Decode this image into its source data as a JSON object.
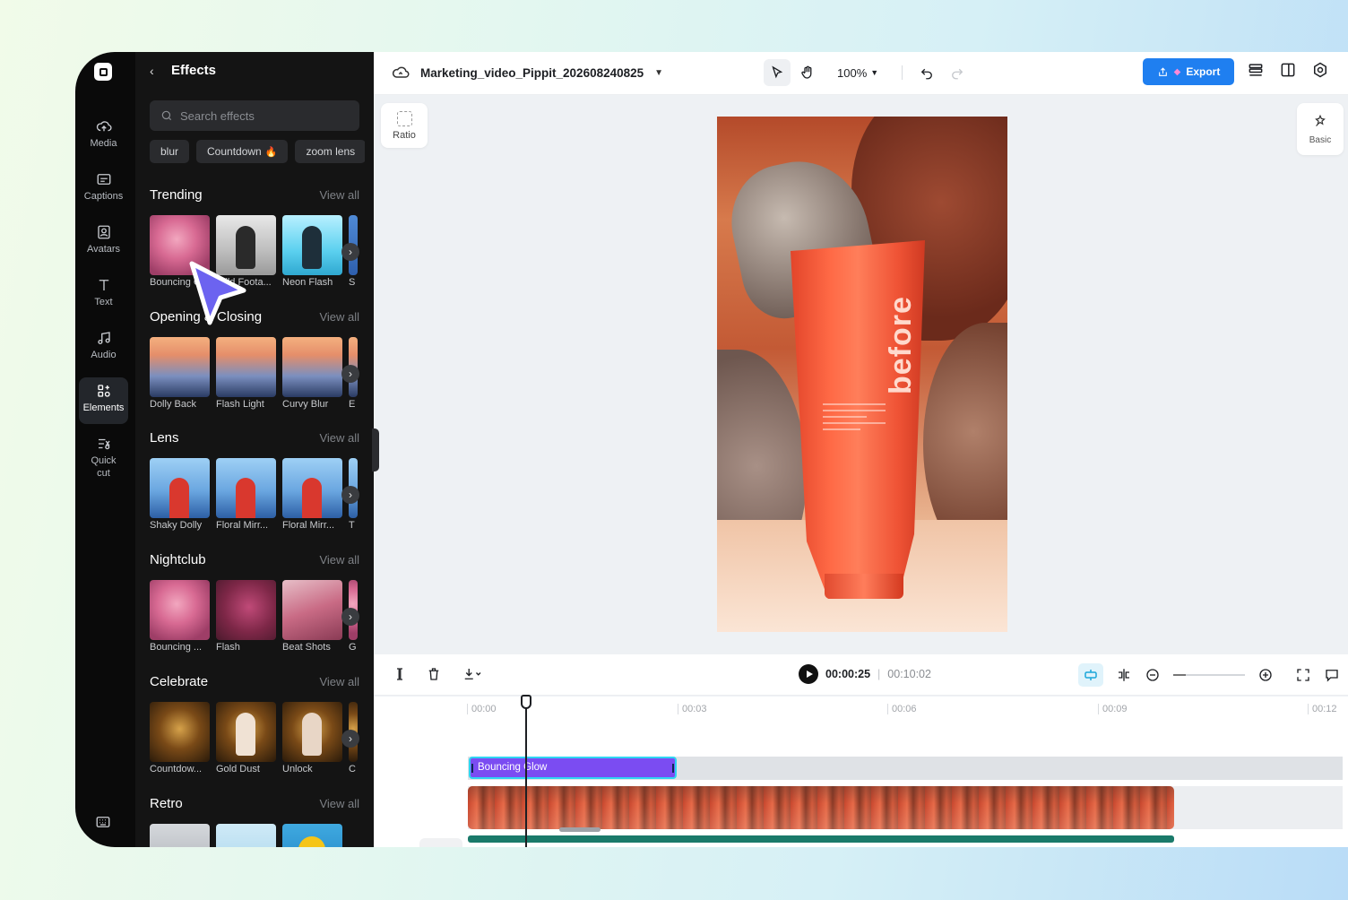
{
  "rail": {
    "items": [
      {
        "label": "Media",
        "icon": "cloud-upload-icon"
      },
      {
        "label": "Captions",
        "icon": "captions-icon"
      },
      {
        "label": "Avatars",
        "icon": "avatar-icon"
      },
      {
        "label": "Text",
        "icon": "text-icon"
      },
      {
        "label": "Audio",
        "icon": "music-note-icon"
      },
      {
        "label": "Elements",
        "icon": "elements-icon",
        "active": true
      },
      {
        "label": "Quick",
        "label2": "cut",
        "icon": "quick-cut-icon"
      }
    ]
  },
  "panel": {
    "title": "Effects",
    "search_placeholder": "Search effects",
    "chips": [
      "blur",
      "Countdown",
      "zoom lens"
    ],
    "view_all": "View all",
    "sections": [
      {
        "title": "Trending",
        "items": [
          "Bouncing Glow",
          "Wild Foota...",
          "Neon Flash",
          "S"
        ]
      },
      {
        "title": "Opening & Closing",
        "items": [
          "Dolly Back",
          "Flash Light",
          "Curvy Blur",
          "E"
        ]
      },
      {
        "title": "Lens",
        "items": [
          "Shaky Dolly",
          "Floral Mirr...",
          "Floral Mirr...",
          "T"
        ]
      },
      {
        "title": "Nightclub",
        "items": [
          "Bouncing ...",
          "Flash",
          "Beat Shots",
          "G"
        ]
      },
      {
        "title": "Celebrate",
        "items": [
          "Countdow...",
          "Gold Dust",
          "Unlock",
          "C"
        ]
      },
      {
        "title": "Retro",
        "items": [
          "",
          "",
          "",
          ""
        ]
      }
    ]
  },
  "topbar": {
    "project_name": "Marketing_video_Pippit_202608240825",
    "zoom": "100%",
    "export_label": "Export"
  },
  "canvas": {
    "ratio_label": "Ratio",
    "basic_label": "Basic",
    "tube_text": "before"
  },
  "timeline": {
    "current_time": "00:00:25",
    "divider": "|",
    "total_time": "00:10:02",
    "ruler": [
      "00:00",
      "00:03",
      "00:06",
      "00:09",
      "00:12"
    ],
    "effect_clip_label": "Bouncing Glow"
  },
  "colors": {
    "accent": "#1f7ff0",
    "effect_clip": "#7b4cf2",
    "effect_clip_border": "#2fd4f2",
    "cursor": "#6c63f0"
  }
}
